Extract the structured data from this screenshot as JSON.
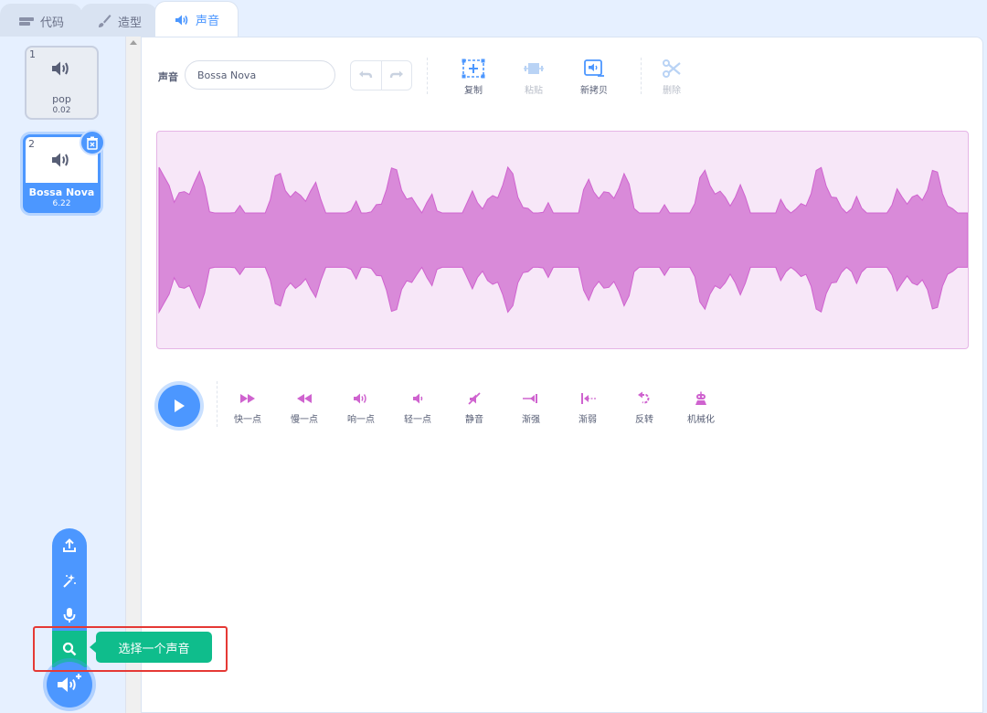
{
  "tabs": [
    {
      "label": "代码",
      "icon": "code-icon"
    },
    {
      "label": "造型",
      "icon": "brush-icon"
    },
    {
      "label": "声音",
      "icon": "speaker-icon"
    }
  ],
  "sounds": [
    {
      "number": "1",
      "name": "pop",
      "duration": "0.02",
      "icon": "speaker-icon"
    },
    {
      "number": "2",
      "name": "Bossa Nova",
      "duration": "6.22",
      "icon": "speaker-icon"
    }
  ],
  "editor": {
    "sound_label": "声音",
    "sound_name": "Bossa Nova",
    "tools": {
      "copy": "复制",
      "paste": "粘贴",
      "copy_new": "新拷贝",
      "delete": "删除"
    },
    "effects": [
      "快一点",
      "慢一点",
      "响一点",
      "轻一点",
      "静音",
      "渐强",
      "渐弱",
      "反转",
      "机械化"
    ]
  },
  "add_menu": {
    "tooltip": "选择一个声音",
    "items": [
      "upload-icon",
      "surprise-icon",
      "microphone-icon",
      "search-icon"
    ]
  },
  "colors": {
    "accent": "#4c97ff",
    "sound_magenta": "#cf63cf",
    "wave_fill": "#d98ad9",
    "green": "#0fbd8c",
    "highlight": "#e53935"
  }
}
